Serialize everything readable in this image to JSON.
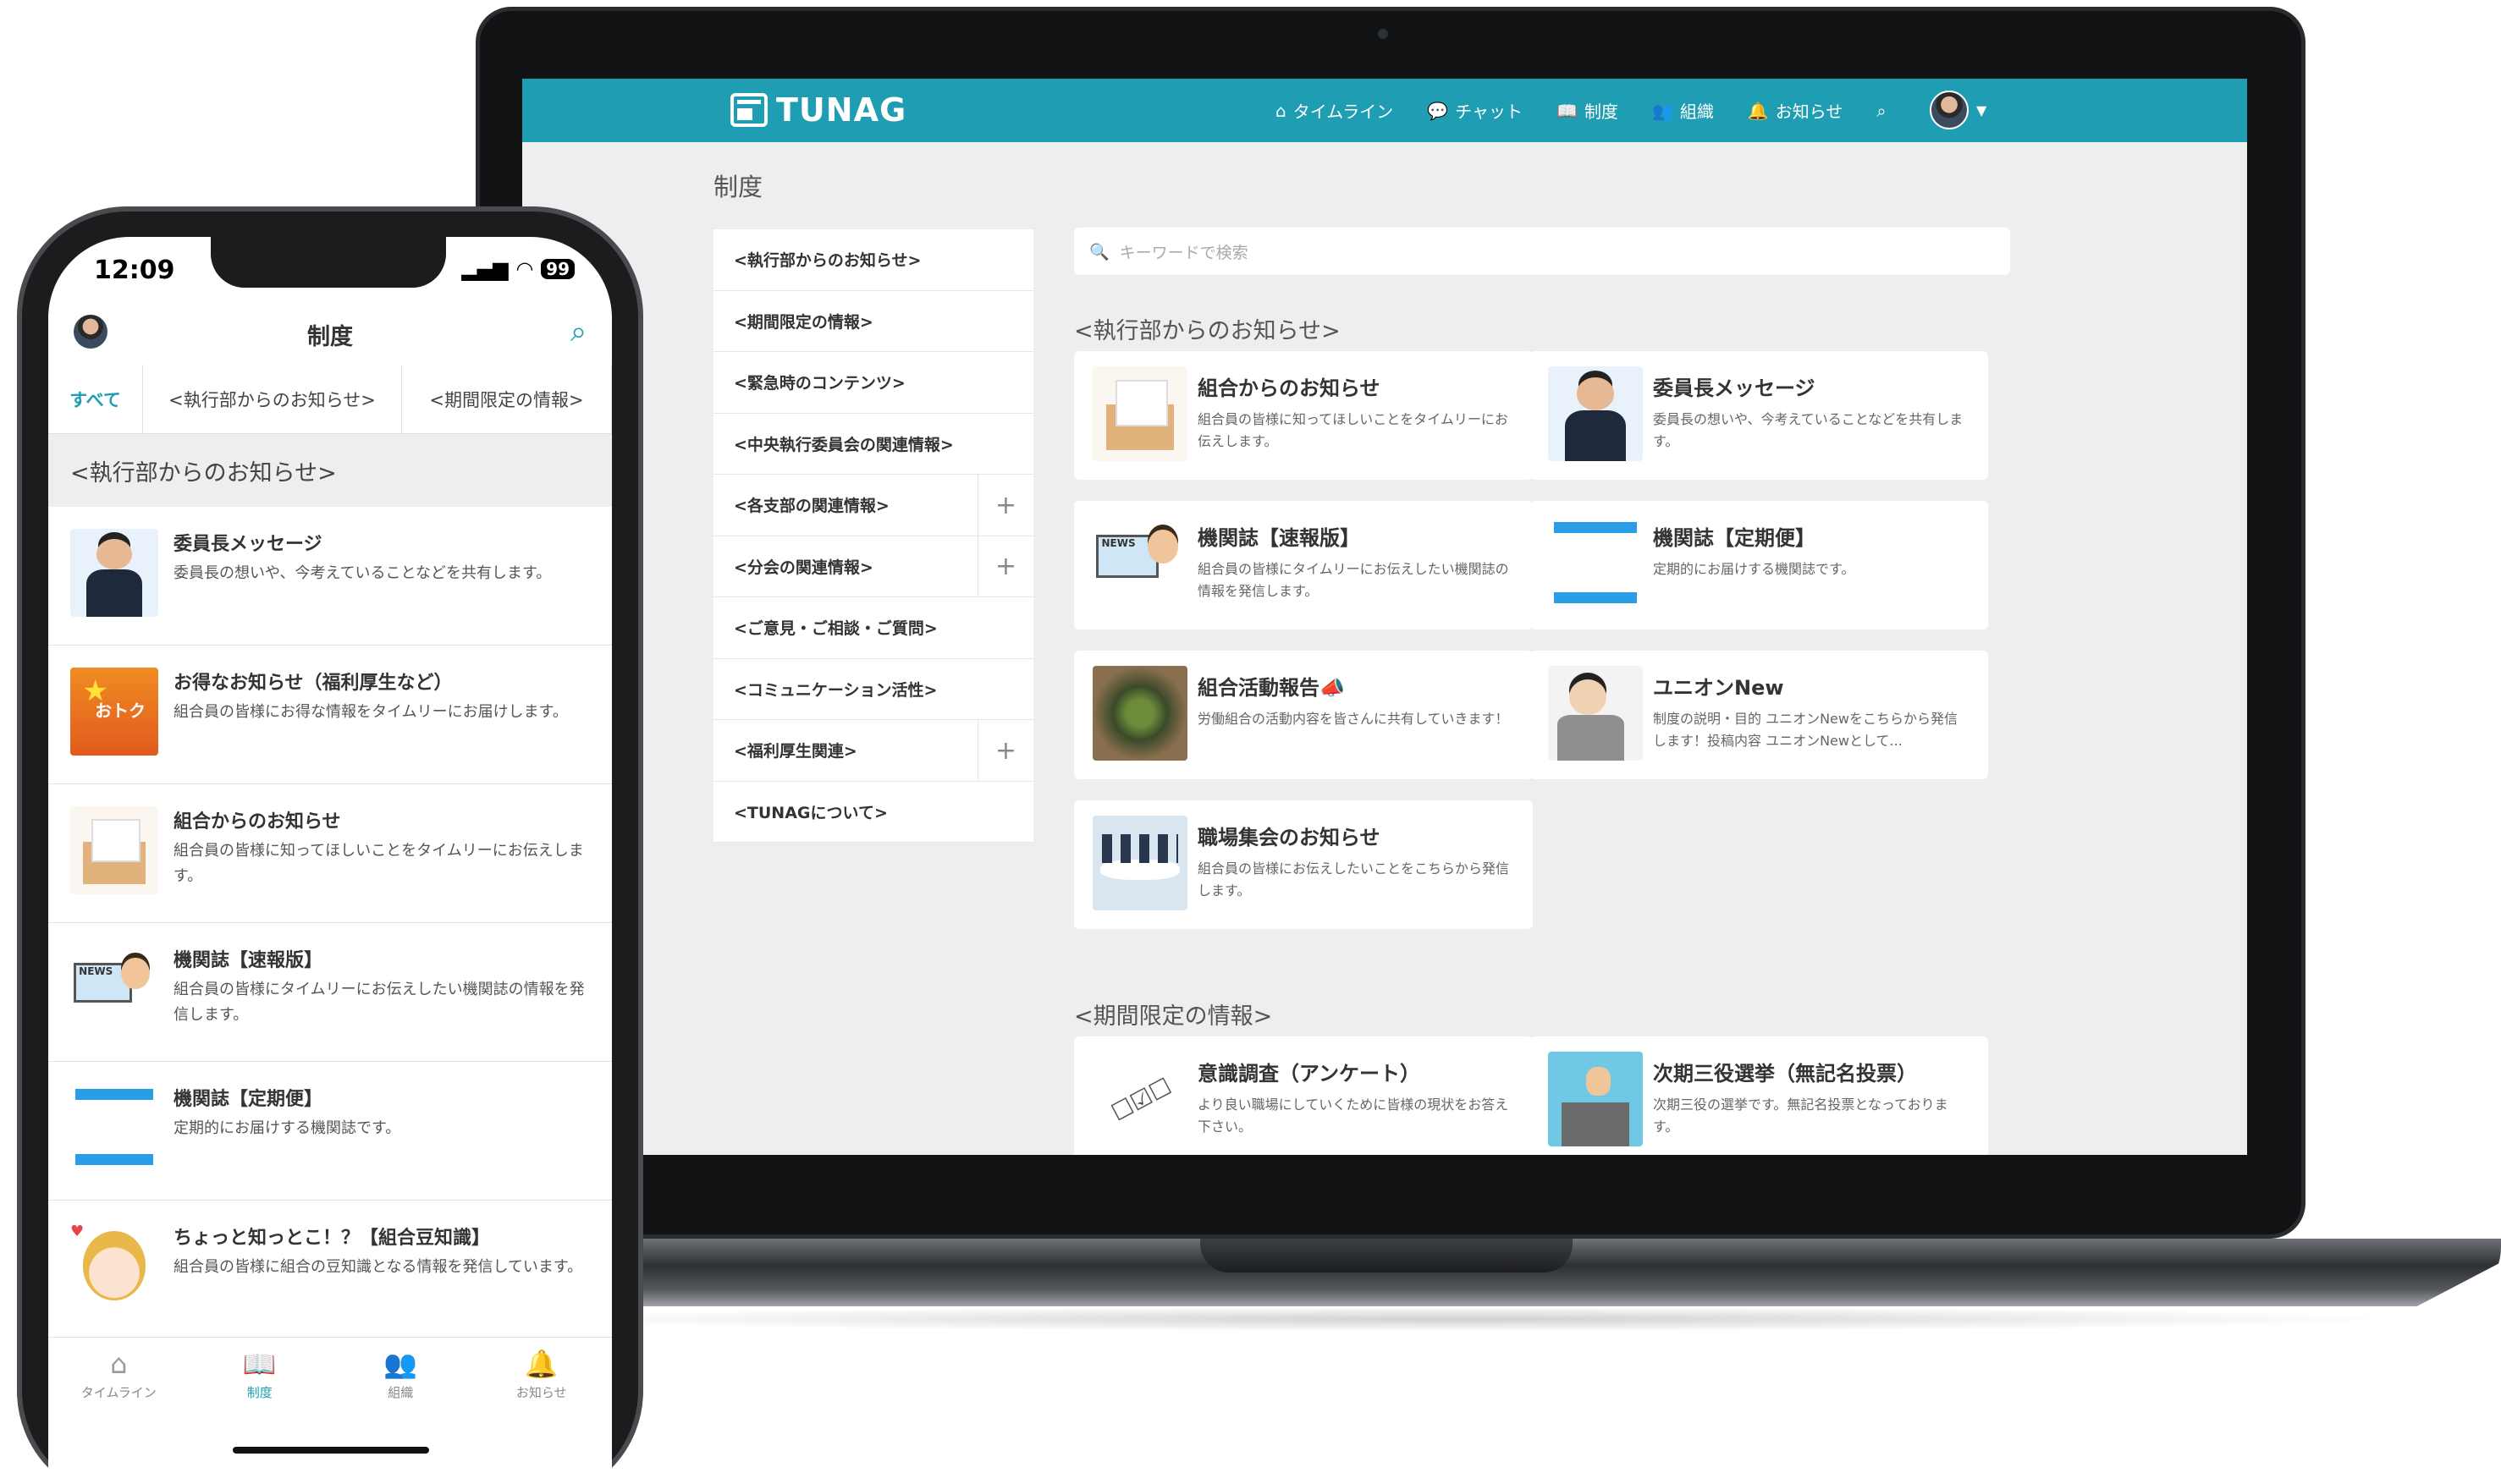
{
  "laptop": {
    "brand": "TUNAG",
    "nav": [
      {
        "icon": "home-icon",
        "glyph": "⌂",
        "label": "タイムライン"
      },
      {
        "icon": "chat-icon",
        "glyph": "💬",
        "label": "チャット"
      },
      {
        "icon": "book-icon",
        "glyph": "📖",
        "label": "制度"
      },
      {
        "icon": "group-icon",
        "glyph": "👥",
        "label": "組織"
      },
      {
        "icon": "bell-icon",
        "glyph": "🔔",
        "label": "お知らせ"
      }
    ],
    "page_title": "制度",
    "search_placeholder": "キーワードで検索",
    "sidebar": [
      {
        "label": "<執行部からのお知らせ>",
        "expandable": false
      },
      {
        "label": "<期間限定の情報>",
        "expandable": false
      },
      {
        "label": "<緊急時のコンテンツ>",
        "expandable": false
      },
      {
        "label": "<中央執行委員会の関連情報>",
        "expandable": false
      },
      {
        "label": "<各支部の関連情報>",
        "expandable": true
      },
      {
        "label": "<分会の関連情報>",
        "expandable": true
      },
      {
        "label": "<ご意見・ご相談・ご質問>",
        "expandable": false
      },
      {
        "label": "<コミュニケーション活性>",
        "expandable": false
      },
      {
        "label": "<福利厚生関連>",
        "expandable": true
      },
      {
        "label": "<TUNAGについて>",
        "expandable": false
      }
    ],
    "sections": [
      {
        "title": "<執行部からのお知らせ>",
        "cards": [
          {
            "title": "組合からのお知らせ",
            "desc": "組合員の皆様に知ってほしいことをタイムリーにお伝えします。",
            "art": "envelope"
          },
          {
            "title": "委員長メッセージ",
            "desc": "委員長の想いや、今考えていることなどを共有します。",
            "art": "man"
          },
          {
            "title": "機関誌【速報版】",
            "desc": "組合員の皆様にタイムリーにお伝えしたい機関誌の情報を発信します。",
            "art": "news"
          },
          {
            "title": "機関誌【定期便】",
            "desc": "定期的にお届けする機関誌です。",
            "art": "book"
          },
          {
            "title": "組合活動報告📣",
            "desc": "労働組合の活動内容を皆さんに共有していきます！",
            "art": "hands"
          },
          {
            "title": "ユニオンNew",
            "desc": "制度の説明・目的 ユニオンNewをこちらから発信します！投稿内容 ユニオンNewとして...",
            "art": "union"
          },
          {
            "title": "職場集会のお知らせ",
            "desc": "組合員の皆様にお伝えしたいことをこちらから発信します。",
            "art": "meeting"
          }
        ]
      },
      {
        "title": "<期間限定の情報>",
        "cards": [
          {
            "title": "意識調査（アンケート）",
            "desc": "より良い職場にしていくために皆様の現状をお答え下さい。",
            "art": "survey"
          },
          {
            "title": "次期三役選挙（無記名投票）",
            "desc": "次期三役の選挙です。無記名投票となっております。",
            "art": "vote"
          }
        ]
      }
    ]
  },
  "phone": {
    "time": "12:09",
    "battery": "99",
    "title": "制度",
    "tabs": [
      {
        "label": "すべて",
        "active": true
      },
      {
        "label": "<執行部からのお知らせ>",
        "active": false
      },
      {
        "label": "<期間限定の情報>",
        "active": false
      }
    ],
    "section_title": "<執行部からのお知らせ>",
    "rows": [
      {
        "title": "委員長メッセージ",
        "desc": "委員長の想いや、今考えていることなどを共有します。",
        "art": "man"
      },
      {
        "title": "お得なお知らせ（福利厚生など）",
        "desc": "組合員の皆様にお得な情報をタイムリーにお届けします。",
        "art": "otoku"
      },
      {
        "title": "組合からのお知らせ",
        "desc": "組合員の皆様に知ってほしいことをタイムリーにお伝えします。",
        "art": "envelope"
      },
      {
        "title": "機関誌【速報版】",
        "desc": "組合員の皆様にタイムリーにお伝えしたい機関誌の情報を発信します。",
        "art": "news"
      },
      {
        "title": "機関誌【定期便】",
        "desc": "定期的にお届けする機関誌です。",
        "art": "book"
      },
      {
        "title": "ちょっと知っとこ！？【組合豆知識】",
        "desc": "組合員の皆様に組合の豆知識となる情報を発信しています。",
        "art": "girl"
      }
    ],
    "bottom_nav": [
      {
        "icon": "home-icon",
        "glyph": "⌂",
        "label": "タイムライン",
        "active": false
      },
      {
        "icon": "book-icon",
        "glyph": "📖",
        "label": "制度",
        "active": true
      },
      {
        "icon": "group-icon",
        "glyph": "👥",
        "label": "組織",
        "active": false
      },
      {
        "icon": "bell-icon",
        "glyph": "🔔",
        "label": "お知らせ",
        "active": false
      }
    ]
  },
  "colors": {
    "brand": "#1f9db2",
    "background": "#edeef0"
  }
}
